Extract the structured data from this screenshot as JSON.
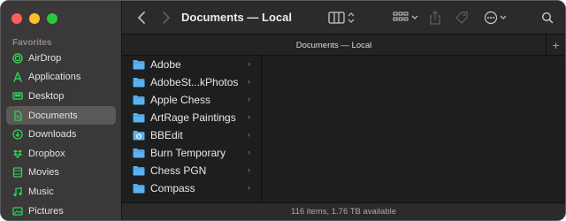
{
  "window": {
    "title": "Documents — Local"
  },
  "tab": {
    "label": "Documents — Local",
    "add_label": "+"
  },
  "sidebar": {
    "section_title": "Favorites",
    "items": [
      {
        "label": "AirDrop",
        "icon": "airdrop-icon",
        "selected": false
      },
      {
        "label": "Applications",
        "icon": "applications-icon",
        "selected": false
      },
      {
        "label": "Desktop",
        "icon": "desktop-icon",
        "selected": false
      },
      {
        "label": "Documents",
        "icon": "document-icon",
        "selected": true
      },
      {
        "label": "Downloads",
        "icon": "download-icon",
        "selected": false
      },
      {
        "label": "Dropbox",
        "icon": "dropbox-icon",
        "selected": false
      },
      {
        "label": "Movies",
        "icon": "movies-icon",
        "selected": false
      },
      {
        "label": "Music",
        "icon": "music-icon",
        "selected": false
      },
      {
        "label": "Pictures",
        "icon": "pictures-icon",
        "selected": false
      }
    ]
  },
  "files": [
    {
      "name": "Adobe",
      "icon": "folder-icon"
    },
    {
      "name": "AdobeSt...kPhotos",
      "icon": "folder-icon"
    },
    {
      "name": "Apple Chess",
      "icon": "folder-icon"
    },
    {
      "name": "ArtRage Paintings",
      "icon": "folder-icon"
    },
    {
      "name": "BBEdit",
      "icon": "bbedit-folder-icon"
    },
    {
      "name": "Burn Temporary",
      "icon": "folder-icon"
    },
    {
      "name": "Chess PGN",
      "icon": "folder-icon"
    },
    {
      "name": "Compass",
      "icon": "folder-icon"
    }
  ],
  "status": {
    "text": "116 items, 1.76 TB available"
  },
  "colors": {
    "accent_green": "#30d158",
    "folder_blue": "#5ab3f0"
  }
}
